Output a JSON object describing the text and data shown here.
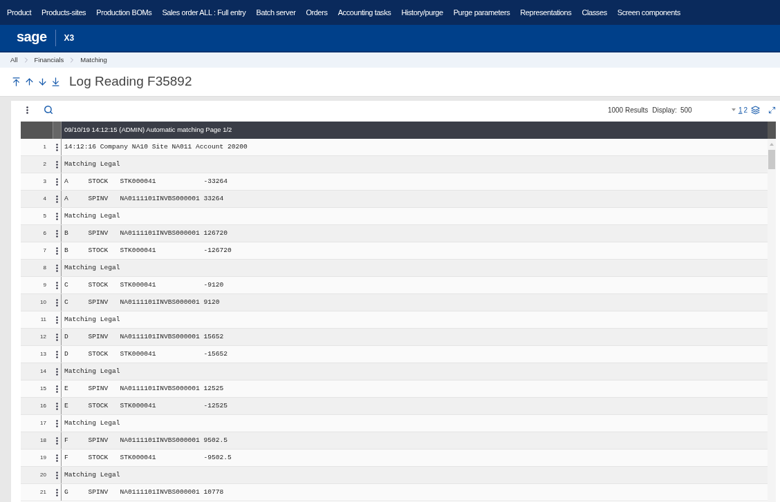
{
  "top_menu": [
    {
      "label": "Product"
    },
    {
      "label": "Products-sites"
    },
    {
      "label": "Production BOMs"
    },
    {
      "label": "Sales order ALL : Full entry"
    },
    {
      "label": "Batch server"
    },
    {
      "label": "Orders"
    },
    {
      "label": "Accounting tasks"
    },
    {
      "label": "History/purge"
    },
    {
      "label": "Purge parameters"
    },
    {
      "label": "Representations"
    },
    {
      "label": "Classes"
    },
    {
      "label": "Screen components"
    }
  ],
  "brand": {
    "logo": "sage",
    "product": "X3"
  },
  "breadcrumbs": [
    "All",
    "Financials",
    "Matching"
  ],
  "title": "Log Reading F35892",
  "toolbar": {
    "results": "1000 Results",
    "display_label": "Display:",
    "display_value": "500",
    "pages": [
      {
        "label": "1",
        "selected": true
      },
      {
        "label": "2",
        "selected": false
      }
    ]
  },
  "table": {
    "header": "09/10/19 14:12:15 (ADMIN) Automatic matching Page 1/2",
    "rows": [
      {
        "number": "1",
        "text": "14:12:16 Company NA10 Site NA011 Account 20200"
      },
      {
        "number": "2",
        "text": "Matching Legal"
      },
      {
        "number": "3",
        "text": "A     STOCK   STK000041            -33264"
      },
      {
        "number": "4",
        "text": "A     SPINV   NA0111101INVBS000001 33264"
      },
      {
        "number": "5",
        "text": "Matching Legal"
      },
      {
        "number": "6",
        "text": "B     SPINV   NA0111101INVBS000001 126720"
      },
      {
        "number": "7",
        "text": "B     STOCK   STK000041            -126720"
      },
      {
        "number": "8",
        "text": "Matching Legal"
      },
      {
        "number": "9",
        "text": "C     STOCK   STK000041            -9120"
      },
      {
        "number": "10",
        "text": "C     SPINV   NA0111101INVBS000001 9120"
      },
      {
        "number": "11",
        "text": "Matching Legal"
      },
      {
        "number": "12",
        "text": "D     SPINV   NA0111101INVBS000001 15652"
      },
      {
        "number": "13",
        "text": "D     STOCK   STK000041            -15652"
      },
      {
        "number": "14",
        "text": "Matching Legal"
      },
      {
        "number": "15",
        "text": "E     SPINV   NA0111101INVBS000001 12525"
      },
      {
        "number": "16",
        "text": "E     STOCK   STK000041            -12525"
      },
      {
        "number": "17",
        "text": "Matching Legal"
      },
      {
        "number": "18",
        "text": "F     SPINV   NA0111101INVBS000001 9502.5"
      },
      {
        "number": "19",
        "text": "F     STOCK   STK000041            -9502.5"
      },
      {
        "number": "20",
        "text": "Matching Legal"
      },
      {
        "number": "21",
        "text": "G     SPINV   NA0111101INVBS000001 10778"
      }
    ]
  }
}
